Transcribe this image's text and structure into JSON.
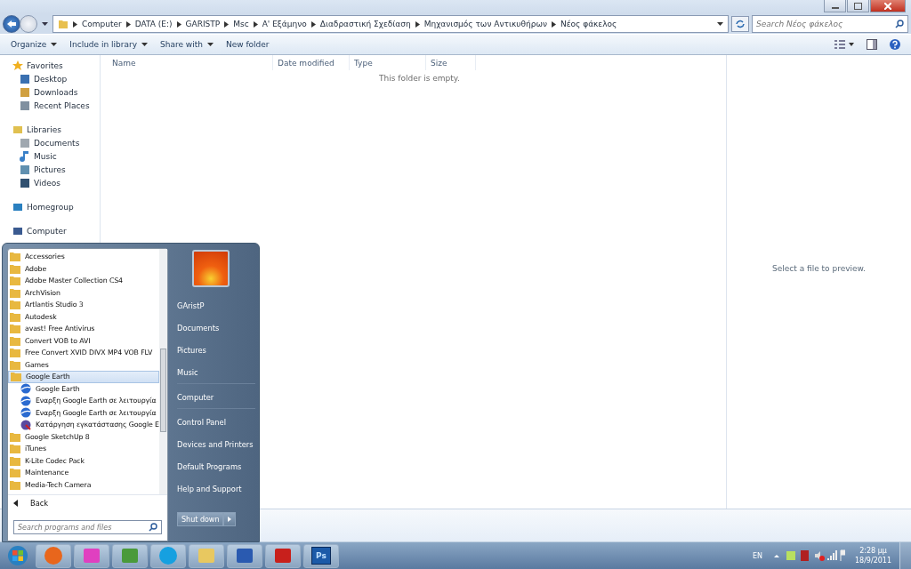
{
  "window": {
    "buttons": [
      {
        "kind": "minimize"
      },
      {
        "kind": "maximize"
      },
      {
        "kind": "close"
      }
    ]
  },
  "address_bar": {
    "path": [
      "Computer",
      "DATA (E:)",
      "GARISTP",
      "Msc",
      "Α' Εξάμηνο",
      "Διαδραστική Σχεδίαση",
      "Μηχανισμός των Αντικυθήρων",
      "Νέος φάκελος"
    ],
    "search_placeholder": "Search Νέος φάκελος"
  },
  "toolbar": {
    "items": [
      {
        "label": "Organize",
        "dropdown": true
      },
      {
        "label": "Include in library",
        "dropdown": true
      },
      {
        "label": "Share with",
        "dropdown": true
      },
      {
        "label": "New folder",
        "dropdown": false
      }
    ]
  },
  "nav_pane": {
    "groups": [
      {
        "label": "Favorites",
        "kind": "star",
        "children": [
          {
            "label": "Desktop",
            "kind": "desktop"
          },
          {
            "label": "Downloads",
            "kind": "downloads"
          },
          {
            "label": "Recent Places",
            "kind": "recent"
          }
        ]
      },
      {
        "label": "Libraries",
        "kind": "library",
        "children": [
          {
            "label": "Documents",
            "kind": "document"
          },
          {
            "label": "Music",
            "kind": "music"
          },
          {
            "label": "Pictures",
            "kind": "picture"
          },
          {
            "label": "Videos",
            "kind": "video"
          }
        ]
      },
      {
        "label": "Homegroup",
        "kind": "homegroup"
      },
      {
        "label": "Computer",
        "kind": "computer"
      }
    ]
  },
  "file_list": {
    "columns": [
      "Name",
      "Date modified",
      "Type",
      "Size"
    ],
    "empty_message": "This folder is empty."
  },
  "preview_pane": {
    "message": "Select a file to preview."
  },
  "start_menu": {
    "programs": [
      {
        "label": "Accessories",
        "kind": "folder",
        "selected": false
      },
      {
        "label": "Adobe",
        "kind": "folder",
        "selected": false
      },
      {
        "label": "Adobe Master Collection CS4",
        "kind": "folder",
        "selected": false
      },
      {
        "label": "ArchVision",
        "kind": "folder",
        "selected": false
      },
      {
        "label": "Artlantis Studio 3",
        "kind": "folder",
        "selected": false
      },
      {
        "label": "Autodesk",
        "kind": "folder",
        "selected": false
      },
      {
        "label": "avast! Free Antivirus",
        "kind": "folder",
        "selected": false
      },
      {
        "label": "Convert VOB to AVI",
        "kind": "folder",
        "selected": false
      },
      {
        "label": "Free Convert XVID DIVX MP4 VOB FLV",
        "kind": "folder",
        "selected": false
      },
      {
        "label": "Games",
        "kind": "folder",
        "selected": false
      },
      {
        "label": "Google Earth",
        "kind": "folder",
        "selected": true,
        "expanded": true,
        "children": [
          {
            "label": "Google Earth",
            "kind": "globe",
            "selected": false
          },
          {
            "label": "Εναρξη Google Earth σε λειτουργία",
            "kind": "globe",
            "selected": false
          },
          {
            "label": "Εναρξη Google Earth σε λειτουργία",
            "kind": "globe",
            "selected": false
          },
          {
            "label": "Κατάργηση εγκατάστασης Google E",
            "kind": "uninstall",
            "selected": false
          }
        ]
      },
      {
        "label": "Google SketchUp 8",
        "kind": "folder",
        "selected": false
      },
      {
        "label": "iTunes",
        "kind": "folder",
        "selected": false
      },
      {
        "label": "K-Lite Codec Pack",
        "kind": "folder",
        "selected": false
      },
      {
        "label": "Maintenance",
        "kind": "folder",
        "selected": false
      },
      {
        "label": "Media-Tech Camera",
        "kind": "folder",
        "selected": false
      }
    ],
    "back_label": "Back",
    "search_placeholder": "Search programs and files",
    "places": [
      {
        "label": "GAristP",
        "separator_after": false
      },
      {
        "label": "Documents",
        "separator_after": false
      },
      {
        "label": "Pictures",
        "separator_after": false
      },
      {
        "label": "Music",
        "separator_after": true
      },
      {
        "label": "Computer",
        "separator_after": true
      },
      {
        "label": "Control Panel",
        "separator_after": false
      },
      {
        "label": "Devices and Printers",
        "separator_after": false
      },
      {
        "label": "Default Programs",
        "separator_after": false
      },
      {
        "label": "Help and Support",
        "separator_after": false
      }
    ],
    "shutdown_label": "Shut down"
  },
  "taskbar": {
    "apps": [
      {
        "kind": "firefox"
      },
      {
        "kind": "messenger"
      },
      {
        "kind": "people"
      },
      {
        "kind": "skype"
      },
      {
        "kind": "explorer"
      },
      {
        "kind": "word"
      },
      {
        "kind": "acrobat"
      },
      {
        "kind": "photoshop",
        "label": "Ps"
      }
    ],
    "language": "EN",
    "time": "2:28 μμ",
    "date": "18/9/2011"
  }
}
